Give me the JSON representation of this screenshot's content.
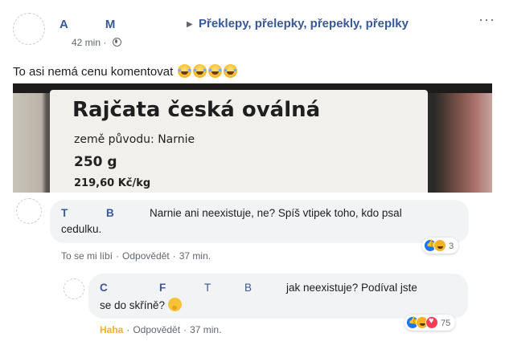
{
  "post": {
    "author_first": "A",
    "author_last": "M",
    "group": "Překlepy, přelepky, přepekly, přeplky",
    "time": "42 min",
    "more": "···",
    "text": "To asi nemá cenu komentovat",
    "emoji_count": 4
  },
  "photo": {
    "title": "Rajčata česká oválná",
    "origin": "země původu: Narnie",
    "weight": "250 g",
    "price": "219,60 Kč/kg"
  },
  "comments": [
    {
      "name_first": "T",
      "name_last": "B",
      "line1": "Narnie ani neexistuje, ne? Spíš vtipek toho, kdo psal",
      "line2": "cedulku.",
      "reaction_count": "3",
      "like": "To se mi líbí",
      "reply": "Odpovědět",
      "time": "37 min."
    },
    {
      "name_c": "C",
      "name_f": "F",
      "name_t": "T",
      "name_b": "B",
      "line1": "jak neexistuje? Podíval jste",
      "line2": "se do skříně?",
      "reaction_count": "75",
      "like": "Haha",
      "reply": "Odpovědět",
      "time": "37 min."
    }
  ],
  "colors": {
    "link": "#385898",
    "bubble": "#f2f3f5",
    "haha": "#f7b125",
    "meta": "#606770"
  },
  "icons": [
    "globe-icon",
    "more-icon",
    "like-reaction-icon",
    "haha-reaction-icon",
    "love-reaction-icon",
    "thinking-emoji-icon",
    "laughing-emoji-icon"
  ]
}
